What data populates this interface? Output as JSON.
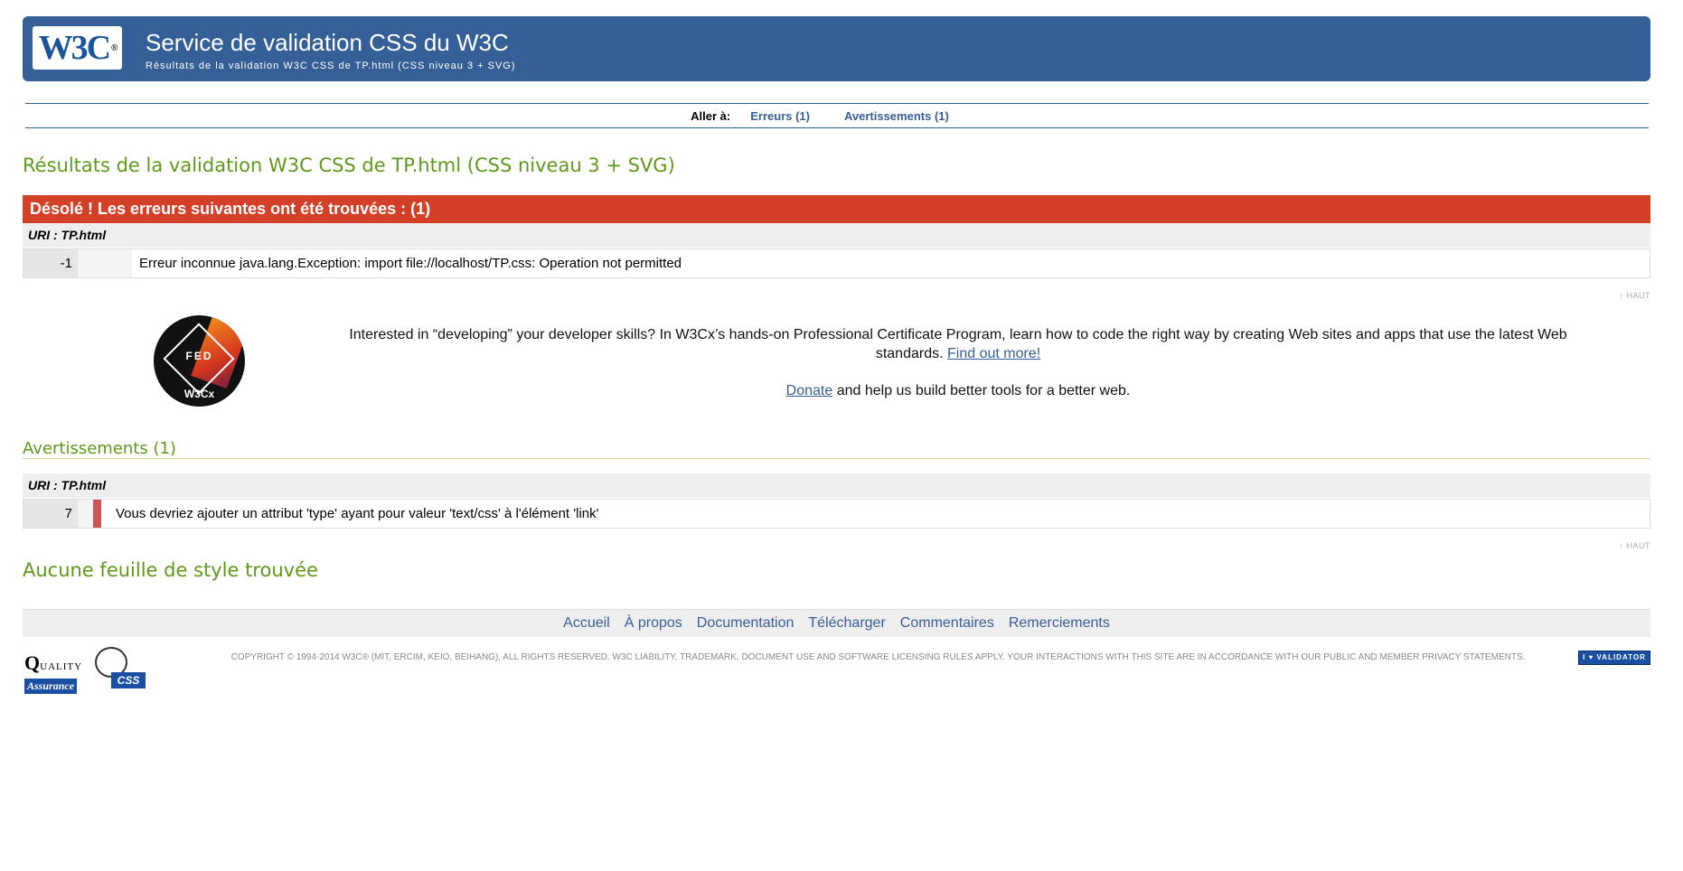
{
  "banner": {
    "logo_text": "W3C",
    "logo_reg": "®",
    "title": "Service de validation CSS du W3C",
    "subtitle": "Résultats de la validation W3C CSS de TP.html (CSS niveau 3 + SVG)"
  },
  "jumpnav": {
    "label": "Aller à:",
    "errors_link": "Erreurs (1)",
    "warnings_link": "Avertissements (1)"
  },
  "results_title": "Résultats de la validation W3C CSS de TP.html (CSS niveau 3 + SVG)",
  "errors": {
    "heading": "Désolé ! Les erreurs suivantes ont été trouvées : (1)",
    "uri": "URI : TP.html",
    "rows": [
      {
        "line": "-1",
        "message": "Erreur inconnue java.lang.Exception: import file://localhost/TP.css: Operation not permitted"
      }
    ]
  },
  "top_link": "↑ HAUT",
  "promo": {
    "badge_center": "FED",
    "badge_bottom": "W3Cx",
    "text": "Interested in “developing” your developer skills? In W3Cx’s hands-on Professional Certificate Program, learn how to code the right way by creating Web sites and apps that use the latest Web standards.",
    "link": "Find out more!",
    "donate_link": "Donate",
    "donate_text": " and help us build better tools for a better web."
  },
  "warnings": {
    "title": "Avertissements (1)",
    "uri": "URI : TP.html",
    "rows": [
      {
        "line": "7",
        "message": "Vous devriez ajouter un attribut 'type' ayant pour valeur 'text/css' à l'élément 'link'"
      }
    ]
  },
  "no_stylesheet": "Aucune feuille de style trouvée",
  "footer_nav": {
    "items": [
      "Accueil",
      "À propos",
      "Documentation",
      "Télécharger",
      "Commentaires",
      "Remerciements"
    ]
  },
  "footer": {
    "qa_q": "Q",
    "qa_uality": "UALITY",
    "qa_assurance": "Assurance",
    "css_tag": "CSS",
    "copyright": "Copyright © 1994-2014 W3C® (MIT, ERCIM, Keio, Beihang), All Rights Reserved. W3C liability, trademark, document use and software licensing rules apply. Your interactions with this site are in accordance with our public and Member privacy statements.",
    "validator_badge": "I ♥ VALIDATOR"
  },
  "colors": {
    "banner": "#355f97",
    "error_header": "#d43f27",
    "heading_green": "#5e9a1a",
    "link_blue": "#355f97"
  }
}
